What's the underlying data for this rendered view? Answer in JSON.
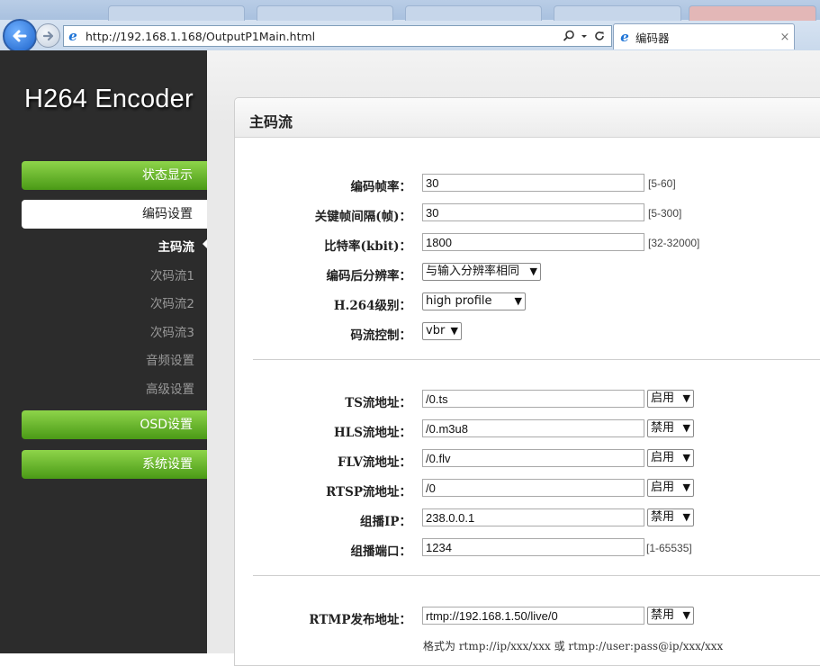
{
  "browser": {
    "url": "http://192.168.1.168/OutputP1Main.html",
    "tab_title": "编码器",
    "tab_close": "×",
    "icons": [
      "back-arrow-icon",
      "forward-arrow-icon",
      "ie-icon",
      "search-icon",
      "refresh-icon"
    ]
  },
  "sidebar": {
    "logo": "H264 Encoder",
    "status_label": "状态显示",
    "encode_label": "编码设置",
    "sub_items": [
      "主码流",
      "次码流1",
      "次码流2",
      "次码流3",
      "音频设置",
      "高级设置"
    ],
    "osd_label": "OSD设置",
    "system_label": "系统设置",
    "colors": {
      "green": "#6bb52e",
      "dark": "#2c2c2c"
    }
  },
  "panel": {
    "title": "主码流",
    "encode": {
      "framerate": {
        "label": "编码帧率：",
        "value": "30",
        "hint": "[5-60]"
      },
      "gop": {
        "label": "关键帧间隔(帧)：",
        "value": "30",
        "hint": "[5-300]"
      },
      "bitrate": {
        "label": "比特率(kbit)：",
        "value": "1800",
        "hint": "[32-32000]"
      },
      "resolution": {
        "label": "编码后分辨率：",
        "value": "与输入分辨率相同"
      },
      "level": {
        "label": "H.264级别：",
        "value": "high profile"
      },
      "rate_control": {
        "label": "码流控制：",
        "value": "vbr"
      }
    },
    "streams": {
      "ts": {
        "label": "TS流地址：",
        "value": "/0.ts",
        "state": "启用"
      },
      "hls": {
        "label": "HLS流地址：",
        "value": "/0.m3u8",
        "state": "禁用"
      },
      "flv": {
        "label": "FLV流地址：",
        "value": "/0.flv",
        "state": "启用"
      },
      "rtsp": {
        "label": "RTSP流地址：",
        "value": "/0",
        "state": "启用"
      },
      "multicast_ip": {
        "label": "组播IP：",
        "value": "238.0.0.1",
        "state": "禁用"
      },
      "multicast_port": {
        "label": "组播端口：",
        "value": "1234",
        "hint": "[1-65535]"
      }
    },
    "rtmp": {
      "label": "RTMP发布地址：",
      "value": "rtmp://192.168.1.50/live/0",
      "state": "禁用",
      "note": "格式为 rtmp://ip/xxx/xxx 或 rtmp://user:pass@ip/xxx/xxx"
    }
  }
}
